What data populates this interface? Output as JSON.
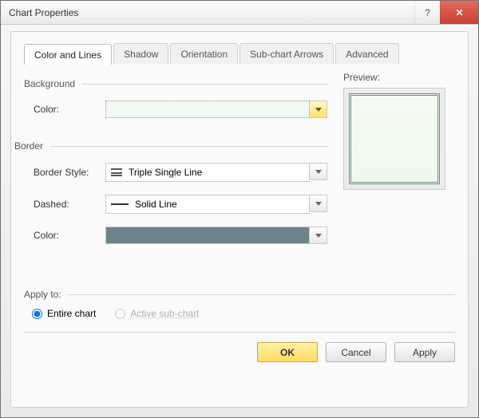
{
  "window": {
    "title": "Chart Properties"
  },
  "tabs": {
    "t0": "Color and Lines",
    "t1": "Shadow",
    "t2": "Orientation",
    "t3": "Sub-chart Arrows",
    "t4": "Advanced"
  },
  "preview": {
    "label": "Preview:"
  },
  "background": {
    "heading": "Background",
    "color_label": "Color:",
    "color_value": "#f1f8f1"
  },
  "border": {
    "heading": "Border",
    "style_label": "Border Style:",
    "style_value": "Triple Single Line",
    "dashed_label": "Dashed:",
    "dashed_value": "Solid Line",
    "color_label": "Color:",
    "color_value": "#6e838b"
  },
  "apply_to": {
    "heading": "Apply to:",
    "entire": "Entire chart",
    "active": "Active sub-chart"
  },
  "buttons": {
    "ok": "OK",
    "cancel": "Cancel",
    "apply": "Apply"
  }
}
